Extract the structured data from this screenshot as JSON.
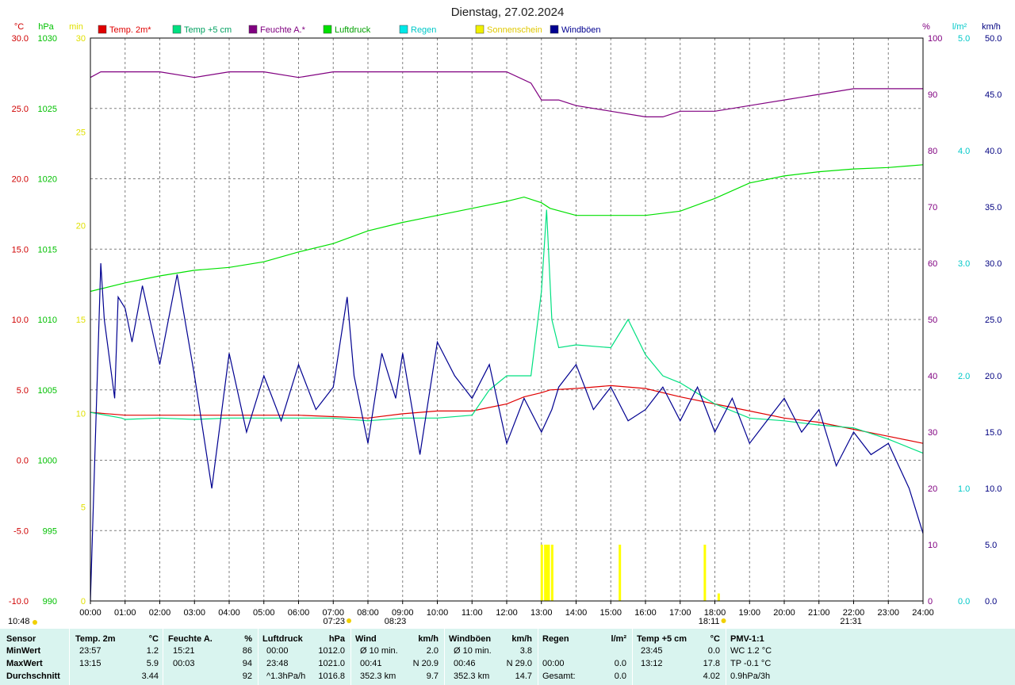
{
  "chart_data": {
    "type": "line",
    "title": "Dienstag, 27.02.2024",
    "x_ticks": [
      "00:00",
      "01:00",
      "02:00",
      "03:00",
      "04:00",
      "05:00",
      "06:00",
      "07:00",
      "08:00",
      "09:00",
      "10:00",
      "11:00",
      "12:00",
      "13:00",
      "14:00",
      "15:00",
      "16:00",
      "17:00",
      "18:00",
      "19:00",
      "20:00",
      "21:00",
      "22:00",
      "23:00",
      "24:00"
    ],
    "xlim": [
      0,
      24
    ],
    "grid": true,
    "axes": {
      "temp": {
        "unit": "°C",
        "ticks": [
          "30.0",
          "25.0",
          "20.0",
          "15.0",
          "10.0",
          "5.0",
          "0.0",
          "-5.0",
          "-10.0"
        ],
        "range": [
          -10,
          30
        ],
        "color": "#d00000"
      },
      "pressure": {
        "unit": "hPa",
        "ticks": [
          "1030",
          "1025",
          "1020",
          "1015",
          "1010",
          "1005",
          "1000",
          "995",
          "990"
        ],
        "range": [
          990,
          1030
        ],
        "color": "#00c000"
      },
      "sunshine": {
        "unit": "min",
        "ticks": [
          "30",
          "25",
          "20",
          "15",
          "10",
          "5",
          "0"
        ],
        "range": [
          0,
          30
        ],
        "color": "#e0e000"
      },
      "humidity": {
        "unit": "%",
        "ticks": [
          "100",
          "90",
          "80",
          "70",
          "60",
          "50",
          "40",
          "30",
          "20",
          "10",
          "0"
        ],
        "range": [
          0,
          100
        ],
        "color": "#800080"
      },
      "rain": {
        "unit": "l/m²",
        "ticks": [
          "5.0",
          "4.0",
          "3.0",
          "2.0",
          "1.0",
          "0.0"
        ],
        "range": [
          0,
          5
        ],
        "color": "#00c8c8"
      },
      "wind": {
        "unit": "km/h",
        "ticks": [
          "50.0",
          "45.0",
          "40.0",
          "35.0",
          "30.0",
          "25.0",
          "20.0",
          "15.0",
          "10.0",
          "5.0",
          "0.0"
        ],
        "range": [
          0,
          50
        ],
        "color": "#000080"
      }
    },
    "legend": [
      {
        "label": "Temp. 2m*",
        "color": "#e00000"
      },
      {
        "label": "Temp +5 cm",
        "color": "#00e080"
      },
      {
        "label": "Feuchte A.*",
        "color": "#800080"
      },
      {
        "label": "Luftdruck",
        "color": "#00e000"
      },
      {
        "label": "Regen",
        "color": "#00e8e8"
      },
      {
        "label": "Sonnenschein",
        "color": "#f0f000"
      },
      {
        "label": "Windböen",
        "color": "#000090"
      }
    ],
    "series": [
      {
        "name": "Temp. 2m*",
        "axis": "temp",
        "color": "#e00000",
        "x": [
          0,
          1,
          2,
          3,
          4,
          5,
          6,
          7,
          8,
          9,
          10,
          11,
          12,
          12.5,
          13,
          13.25,
          14,
          15,
          16,
          17,
          18,
          19,
          20,
          21,
          22,
          23,
          24
        ],
        "y": [
          3.4,
          3.2,
          3.2,
          3.2,
          3.2,
          3.2,
          3.2,
          3.1,
          3.0,
          3.3,
          3.5,
          3.5,
          4.0,
          4.5,
          4.8,
          5.0,
          5.1,
          5.3,
          5.1,
          4.5,
          4.0,
          3.5,
          3.0,
          2.7,
          2.2,
          1.7,
          1.2
        ]
      },
      {
        "name": "Temp +5 cm",
        "axis": "temp",
        "color": "#00e080",
        "x": [
          0,
          0.9,
          1,
          2,
          3,
          4,
          5,
          6,
          7,
          8,
          9,
          10,
          11,
          11.5,
          12,
          12.7,
          13,
          13.15,
          13.3,
          13.5,
          14,
          15,
          15.5,
          16,
          16.5,
          17,
          18,
          19,
          20,
          21,
          22,
          23,
          24
        ],
        "y": [
          3.4,
          3.0,
          2.9,
          3.0,
          2.9,
          3.0,
          3.0,
          3.0,
          3.0,
          2.8,
          3.0,
          3.0,
          3.2,
          5.0,
          6.0,
          6.0,
          12.0,
          17.8,
          10.0,
          8.0,
          8.2,
          8.0,
          10.0,
          7.5,
          6.0,
          5.5,
          4.0,
          3.0,
          2.8,
          2.5,
          2.3,
          1.5,
          0.5
        ]
      },
      {
        "name": "Feuchte A.*",
        "axis": "humidity",
        "color": "#800080",
        "x": [
          0,
          0.3,
          1,
          2,
          3,
          4,
          5,
          6,
          7,
          8,
          9,
          10,
          11,
          12,
          12.7,
          13,
          13.5,
          14,
          15,
          16,
          16.5,
          17,
          18,
          19,
          20,
          21,
          22,
          23,
          24
        ],
        "y": [
          93,
          94,
          94,
          94,
          93,
          94,
          94,
          93,
          94,
          94,
          94,
          94,
          94,
          94,
          92,
          89,
          89,
          88,
          87,
          86,
          86,
          87,
          87,
          88,
          89,
          90,
          91,
          91,
          91
        ]
      },
      {
        "name": "Luftdruck",
        "axis": "pressure",
        "color": "#00e000",
        "x": [
          0,
          1,
          2,
          3,
          4,
          5,
          6,
          7,
          8,
          9,
          10,
          11,
          12,
          12.5,
          13,
          13.25,
          14,
          15,
          16,
          17,
          18,
          19,
          20,
          21,
          22,
          23,
          24
        ],
        "y": [
          1012.0,
          1012.6,
          1013.1,
          1013.5,
          1013.7,
          1014.1,
          1014.8,
          1015.4,
          1016.3,
          1016.9,
          1017.4,
          1017.9,
          1018.4,
          1018.7,
          1018.3,
          1017.9,
          1017.4,
          1017.4,
          1017.4,
          1017.7,
          1018.6,
          1019.7,
          1020.2,
          1020.5,
          1020.7,
          1020.8,
          1021.0
        ]
      },
      {
        "name": "Windböen",
        "axis": "wind",
        "color": "#000090",
        "x": [
          0,
          0.3,
          0.4,
          0.7,
          0.8,
          1.0,
          1.2,
          1.5,
          2.0,
          2.5,
          3.0,
          3.5,
          4.0,
          4.5,
          5.0,
          5.5,
          6.0,
          6.5,
          7.0,
          7.4,
          7.6,
          8.0,
          8.4,
          8.8,
          9.0,
          9.5,
          10.0,
          10.5,
          11.0,
          11.5,
          12.0,
          12.5,
          13.0,
          13.3,
          13.5,
          14.0,
          14.5,
          15.0,
          15.5,
          16.0,
          16.5,
          17.0,
          17.5,
          18.0,
          18.5,
          19.0,
          19.5,
          20.0,
          20.5,
          21.0,
          21.5,
          22.0,
          22.5,
          23.0,
          23.3,
          23.6,
          23.8,
          24.0
        ],
        "y": [
          0,
          30,
          25,
          18,
          27,
          26,
          23,
          28,
          21,
          29,
          20,
          10,
          22,
          15,
          20,
          16,
          21,
          17,
          19,
          27,
          20,
          14,
          22,
          18,
          22,
          13,
          23,
          20,
          18,
          21,
          14,
          18,
          15,
          17,
          19,
          21,
          17,
          19,
          16,
          17,
          19,
          16,
          19,
          15,
          18,
          14,
          16,
          18,
          15,
          17,
          12,
          15,
          13,
          14,
          12,
          10,
          8,
          6
        ]
      }
    ],
    "bars": {
      "name": "Sonnenschein",
      "axis": "sunshine",
      "color": "#ffff00",
      "x": [
        13.0,
        13.1,
        13.15,
        13.2,
        13.3,
        15.25,
        17.7,
        18.1
      ],
      "values": [
        3,
        3,
        3,
        3,
        3,
        3,
        3,
        0.4
      ]
    },
    "annotations": {
      "sunrise": "07:23",
      "sunset": "18:11",
      "day_start": "10:48",
      "marker_a": "08:23",
      "marker_b": "21:31"
    }
  },
  "table": {
    "headers": {
      "sensor": "Sensor",
      "temp": "Temp. 2m",
      "temp_u": "°C",
      "hum": "Feuchte A.",
      "hum_u": "%",
      "press": "Luftdruck",
      "press_u": "hPa",
      "wind": "Wind",
      "wind_u": "km/h",
      "gust": "Windböen",
      "gust_u": "km/h",
      "rain": "Regen",
      "rain_u": "l/m²",
      "t5": "Temp +5 cm",
      "t5_u": "°C",
      "pmv": "PMV-1:1"
    },
    "rows": [
      {
        "label": "MinWert",
        "temp_t": "23:57",
        "temp_v": "1.2",
        "hum_t": "15:21",
        "hum_v": "86",
        "press_t": "00:00",
        "press_v": "1012.0",
        "wind_t": "Ø 10 min.",
        "wind_v": "2.0",
        "gust_t": "Ø 10 min.",
        "gust_v": "3.8",
        "rain_t": "",
        "rain_v": "",
        "t5_t": "23:45",
        "t5_v": "0.0",
        "pmv": "WC 1.2 °C"
      },
      {
        "label": "MaxWert",
        "temp_t": "13:15",
        "temp_v": "5.9",
        "hum_t": "00:03",
        "hum_v": "94",
        "press_t": "23:48",
        "press_v": "1021.0",
        "wind_t": "00:41",
        "wind_v": "N 20.9",
        "gust_t": "00:46",
        "gust_v": "N 29.0",
        "rain_t": "00:00",
        "rain_v": "0.0",
        "t5_t": "13:12",
        "t5_v": "17.8",
        "pmv": "TP -0.1 °C"
      },
      {
        "label": "Durchschnitt",
        "temp_t": "",
        "temp_v": "3.44",
        "hum_t": "",
        "hum_v": "92",
        "press_t": "^1.3hPa/h",
        "press_v": "1016.8",
        "wind_t": "352.3 km",
        "wind_v": "9.7",
        "gust_t": "352.3 km",
        "gust_v": "14.7",
        "rain_t": "Gesamt:",
        "rain_v": "0.0",
        "t5_t": "",
        "t5_v": "4.02",
        "pmv": "0.9hPa/3h"
      }
    ]
  }
}
